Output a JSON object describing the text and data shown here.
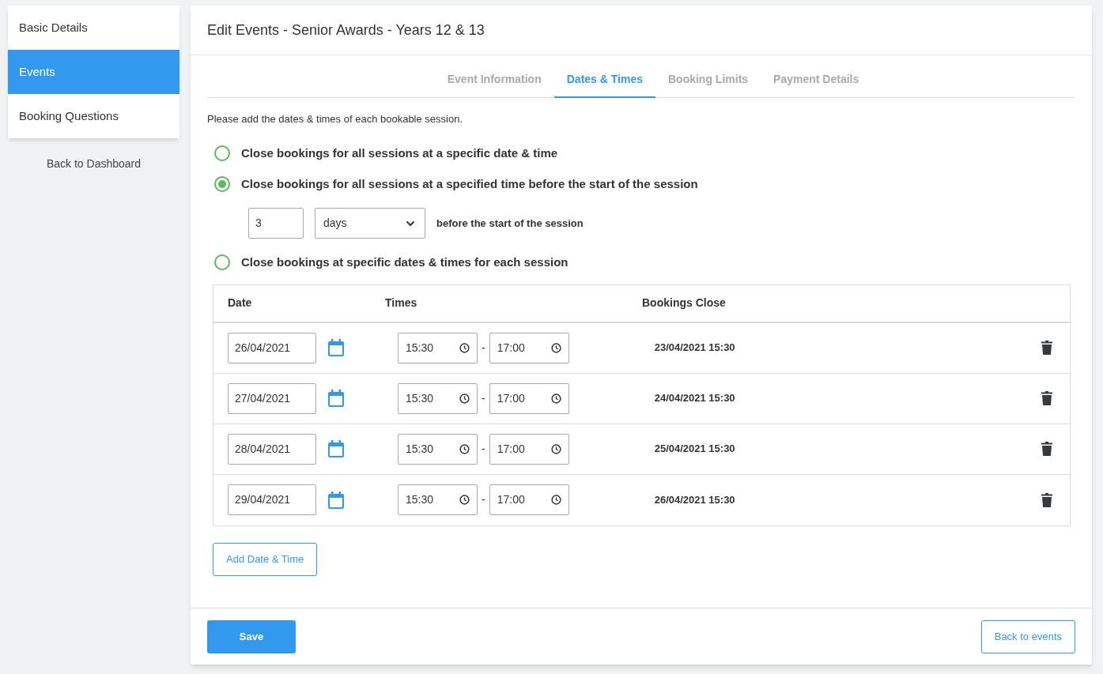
{
  "sidebar": {
    "items": [
      {
        "label": "Basic Details",
        "selected": false
      },
      {
        "label": "Events",
        "selected": true
      },
      {
        "label": "Booking Questions",
        "selected": false
      }
    ],
    "back_link": "Back to Dashboard"
  },
  "page": {
    "title": "Edit Events - Senior Awards - Years 12 & 13"
  },
  "tabs": [
    {
      "label": "Event Information",
      "selected": false
    },
    {
      "label": "Dates & Times",
      "selected": true
    },
    {
      "label": "Booking Limits",
      "selected": false
    },
    {
      "label": "Payment Details",
      "selected": false
    }
  ],
  "intro": "Please add the dates & times of each bookable session.",
  "options": [
    {
      "label": "Close bookings for all sessions at a specific date & time",
      "selected": false
    },
    {
      "label": "Close bookings for all sessions at a specified time before the start of the session",
      "selected": true,
      "amount": "3",
      "unit": "days",
      "suffix": "before the start of the session"
    },
    {
      "label": "Close bookings at specific dates & times for each session",
      "selected": false
    }
  ],
  "table": {
    "columns": [
      "Date",
      "Times",
      "Bookings Close"
    ],
    "separator": "-",
    "rows": [
      {
        "date": "26/04/2021",
        "start": "15:30",
        "end": "17:00",
        "close": "23/04/2021 15:30"
      },
      {
        "date": "27/04/2021",
        "start": "15:30",
        "end": "17:00",
        "close": "24/04/2021 15:30"
      },
      {
        "date": "28/04/2021",
        "start": "15:30",
        "end": "17:00",
        "close": "25/04/2021 15:30"
      },
      {
        "date": "29/04/2021",
        "start": "15:30",
        "end": "17:00",
        "close": "26/04/2021 15:30"
      }
    ]
  },
  "add_button": "Add Date & Time",
  "footer": {
    "save": "Save",
    "back": "Back to events"
  }
}
